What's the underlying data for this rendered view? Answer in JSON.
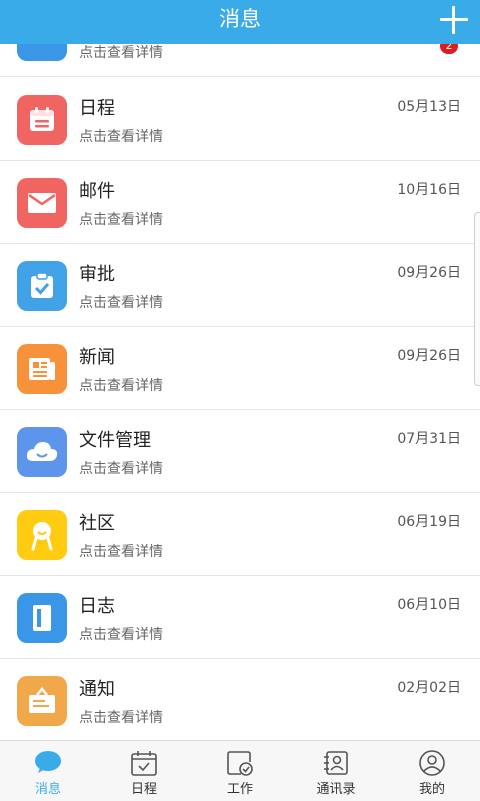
{
  "header": {
    "title": "消息"
  },
  "colors": {
    "accent": "#3aabe9",
    "badge": "#e01b1b"
  },
  "list": {
    "items": [
      {
        "name": "",
        "subtitle": "点击查看详情",
        "date": "",
        "badge": "2",
        "icon": "partial-icon",
        "color": "#3a96e6"
      },
      {
        "name": "日程",
        "subtitle": "点击查看详情",
        "date": "05月13日",
        "icon": "calendar-icon",
        "color": "#f06461"
      },
      {
        "name": "邮件",
        "subtitle": "点击查看详情",
        "date": "10月16日",
        "icon": "mail-icon",
        "color": "#f06461"
      },
      {
        "name": "审批",
        "subtitle": "点击查看详情",
        "date": "09月26日",
        "icon": "clipboard-check-icon",
        "color": "#41a2e8"
      },
      {
        "name": "新闻",
        "subtitle": "点击查看详情",
        "date": "09月26日",
        "icon": "newspaper-icon",
        "color": "#f7923b"
      },
      {
        "name": "文件管理",
        "subtitle": "点击查看详情",
        "date": "07月31日",
        "icon": "cloud-icon",
        "color": "#5d95ec"
      },
      {
        "name": "社区",
        "subtitle": "点击查看详情",
        "date": "06月19日",
        "icon": "community-icon",
        "color": "#ffcc12"
      },
      {
        "name": "日志",
        "subtitle": "点击查看详情",
        "date": "06月10日",
        "icon": "notebook-icon",
        "color": "#3a96e6"
      },
      {
        "name": "通知",
        "subtitle": "点击查看详情",
        "date": "02月02日",
        "icon": "notice-board-icon",
        "color": "#f0a84a"
      }
    ]
  },
  "tabbar": {
    "tabs": [
      {
        "label": "消息",
        "icon": "chat-bubble-icon",
        "active": true
      },
      {
        "label": "日程",
        "icon": "calendar-check-icon",
        "active": false
      },
      {
        "label": "工作",
        "icon": "work-check-icon",
        "active": false
      },
      {
        "label": "通讯录",
        "icon": "contacts-icon",
        "active": false
      },
      {
        "label": "我的",
        "icon": "user-icon",
        "active": false
      }
    ]
  }
}
